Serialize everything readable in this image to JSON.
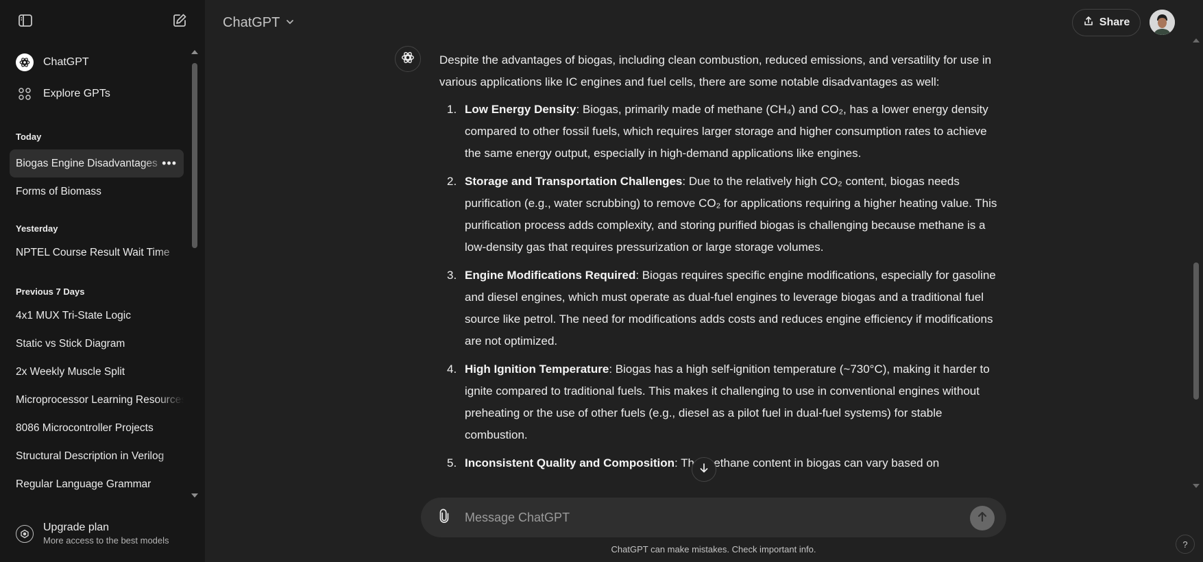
{
  "sidebar": {
    "nav": [
      {
        "label": "ChatGPT",
        "icon": "openai-logo-icon"
      },
      {
        "label": "Explore GPTs",
        "icon": "grid-icon"
      }
    ],
    "groups": [
      {
        "title": "Today",
        "items": [
          "Biogas Engine Disadvantages",
          "Forms of Biomass"
        ]
      },
      {
        "title": "Yesterday",
        "items": [
          "NPTEL Course Result Wait Time"
        ]
      },
      {
        "title": "Previous 7 Days",
        "items": [
          "4x1 MUX Tri-State Logic",
          "Static vs Stick Diagram",
          "2x Weekly Muscle Split",
          "Microprocessor Learning Resources",
          "8086 Microcontroller Projects",
          "Structural Description in Verilog",
          "Regular Language Grammar"
        ]
      }
    ],
    "active_chat": "Biogas Engine Disadvantages",
    "upgrade": {
      "title": "Upgrade plan",
      "subtitle": "More access to the best models"
    }
  },
  "header": {
    "model": "ChatGPT",
    "share_label": "Share"
  },
  "message": {
    "intro": "Despite the advantages of biogas, including clean combustion, reduced emissions, and versatility for use in various applications like IC engines and fuel cells, there are some notable disadvantages as well:",
    "items": [
      {
        "num": "1.",
        "title": "Low Energy Density",
        "text": ": Biogas, primarily made of methane (CH₄) and CO₂, has a lower energy density compared to other fossil fuels, which requires larger storage and higher consumption rates to achieve the same energy output, especially in high-demand applications like engines."
      },
      {
        "num": "2.",
        "title": "Storage and Transportation Challenges",
        "text": ": Due to the relatively high CO₂ content, biogas needs purification (e.g., water scrubbing) to remove CO₂ for applications requiring a higher heating value. This purification process adds complexity, and storing purified biogas is challenging because methane is a low-density gas that requires pressurization or large storage volumes."
      },
      {
        "num": "3.",
        "title": "Engine Modifications Required",
        "text": ": Biogas requires specific engine modifications, especially for gasoline and diesel engines, which must operate as dual-fuel engines to leverage biogas and a traditional fuel source like petrol. The need for modifications adds costs and reduces engine efficiency if modifications are not optimized."
      },
      {
        "num": "4.",
        "title": "High Ignition Temperature",
        "text": ": Biogas has a high self-ignition temperature (~730°C), making it harder to ignite compared to traditional fuels. This makes it challenging to use in conventional engines without preheating or the use of other fuels (e.g., diesel as a pilot fuel in dual-fuel systems) for stable combustion."
      },
      {
        "num": "5.",
        "title": "Inconsistent Quality and Composition",
        "text": ": The methane content in biogas can vary based on"
      }
    ]
  },
  "composer": {
    "placeholder": "Message ChatGPT"
  },
  "disclaimer": "ChatGPT can make mistakes. Check important info.",
  "help_label": "?",
  "colors": {
    "background": "#212121",
    "sidebar": "#171717",
    "composer": "#2f2f2f",
    "text": "#ececec"
  }
}
